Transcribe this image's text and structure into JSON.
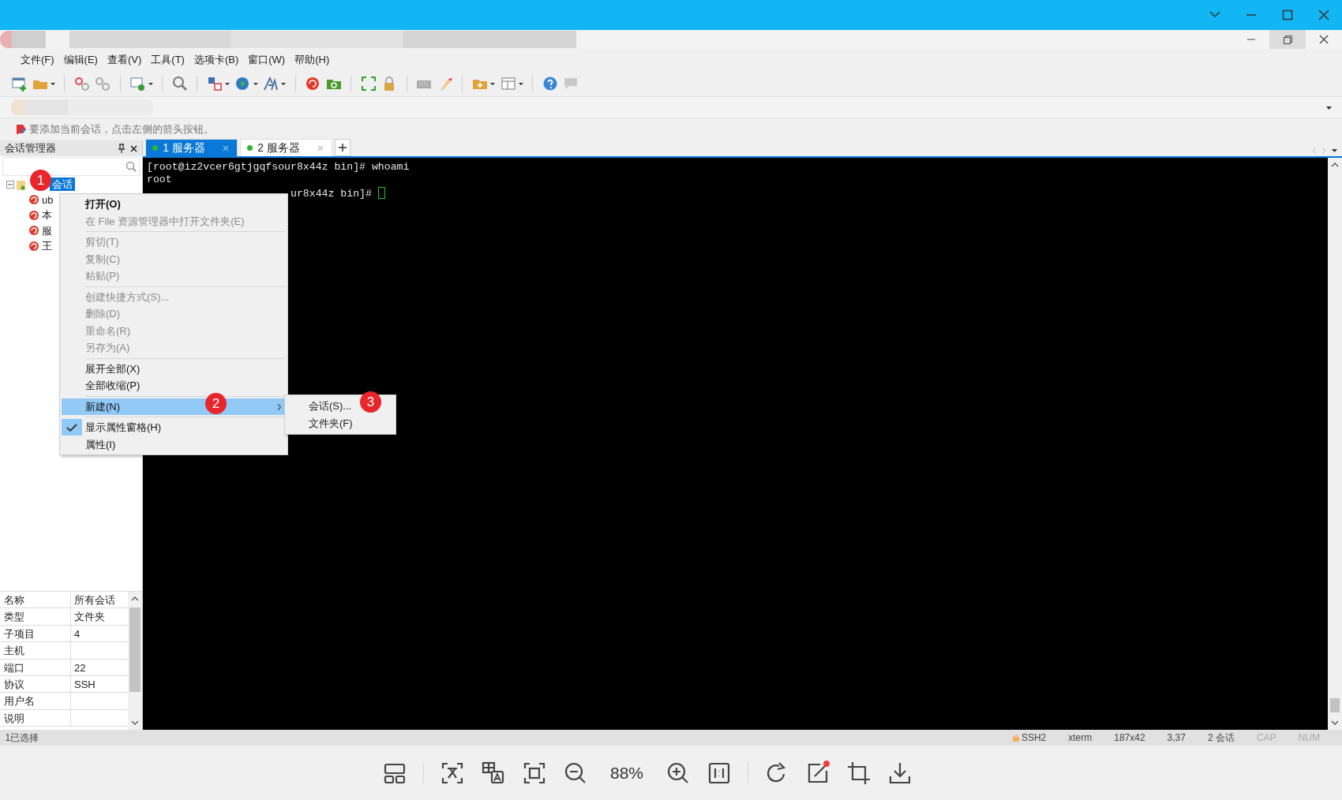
{
  "menu_bar": [
    "文件(F)",
    "编辑(E)",
    "查看(V)",
    "工具(T)",
    "选项卡(B)",
    "窗口(W)",
    "帮助(H)"
  ],
  "hint": "要添加当前会话，点击左侧的箭头按钮。",
  "session_manager": {
    "title": "会话管理器",
    "tree": [
      {
        "label": "会话",
        "selected": true,
        "expanded": true,
        "children": [
          {
            "label": "ub",
            "selected": false
          },
          {
            "label": "本",
            "selected": false
          },
          {
            "label": "服",
            "selected": false
          },
          {
            "label": "王",
            "selected": false
          }
        ]
      }
    ]
  },
  "properties": [
    {
      "name": "名称",
      "value": "所有会话"
    },
    {
      "name": "类型",
      "value": "文件夹"
    },
    {
      "name": "子项目",
      "value": "4"
    },
    {
      "name": "主机"
    },
    {
      "name": "端口",
      "value": "22"
    },
    {
      "name": "协议",
      "value": "SSH"
    },
    {
      "name": "用户名"
    },
    {
      "name": "说明"
    }
  ],
  "tabs": [
    {
      "label": "1 服务器",
      "selected": true
    },
    {
      "label": "2 服务器",
      "selected": false
    }
  ],
  "terminal": {
    "lines": [
      {
        "kind": "full",
        "text": "[root@iz2vcer6gtjgqfsour8x44z bin]# whoami",
        "cursor": false
      },
      {
        "kind": "full",
        "text": "root",
        "cursor": false
      },
      {
        "kind": "tail",
        "text": "ur8x44z bin]#",
        "cursor": true
      }
    ]
  },
  "context_menu": {
    "items": [
      {
        "kind": "item",
        "label": "打开(O)",
        "default": true,
        "disabled": false,
        "selected": false,
        "checked": false,
        "submenu": false
      },
      {
        "kind": "item",
        "label": "在 File 资源管理器中打开文件夹(E)",
        "default": false,
        "disabled": true,
        "selected": false,
        "checked": false,
        "submenu": false
      },
      {
        "kind": "separator"
      },
      {
        "kind": "item",
        "label": "剪切(T)",
        "default": false,
        "disabled": true,
        "selected": false,
        "checked": false,
        "submenu": false
      },
      {
        "kind": "item",
        "label": "复制(C)",
        "default": false,
        "disabled": true,
        "selected": false,
        "checked": false,
        "submenu": false
      },
      {
        "kind": "item",
        "label": "粘贴(P)",
        "default": false,
        "disabled": true,
        "selected": false,
        "checked": false,
        "submenu": false
      },
      {
        "kind": "separator"
      },
      {
        "kind": "item",
        "label": "创建快捷方式(S)...",
        "default": false,
        "disabled": true,
        "selected": false,
        "checked": false,
        "submenu": false
      },
      {
        "kind": "item",
        "label": "删除(D)",
        "default": false,
        "disabled": true,
        "selected": false,
        "checked": false,
        "submenu": false
      },
      {
        "kind": "item",
        "label": "重命名(R)",
        "default": false,
        "disabled": true,
        "selected": false,
        "checked": false,
        "submenu": false
      },
      {
        "kind": "item",
        "label": "另存为(A)",
        "default": false,
        "disabled": true,
        "selected": false,
        "checked": false,
        "submenu": false
      },
      {
        "kind": "separator"
      },
      {
        "kind": "item",
        "label": "展开全部(X)",
        "default": false,
        "disabled": false,
        "selected": false,
        "checked": false,
        "submenu": false
      },
      {
        "kind": "item",
        "label": "全部收缩(P)",
        "default": false,
        "disabled": false,
        "selected": false,
        "checked": false,
        "submenu": false
      },
      {
        "kind": "separator"
      },
      {
        "kind": "item",
        "label": "新建(N)",
        "default": false,
        "disabled": false,
        "selected": true,
        "checked": false,
        "submenu": true
      },
      {
        "kind": "separator"
      },
      {
        "kind": "item",
        "label": "显示属性窗格(H)",
        "default": false,
        "disabled": false,
        "selected": false,
        "checked": true,
        "submenu": false
      },
      {
        "kind": "item",
        "label": "属性(I)",
        "default": false,
        "disabled": false,
        "selected": false,
        "checked": false,
        "submenu": false
      }
    ]
  },
  "submenu": {
    "items": [
      {
        "label": "会话(S)...",
        "selected": false
      },
      {
        "label": "文件夹(F)",
        "selected": false
      }
    ]
  },
  "callouts": [
    "1",
    "2",
    "3"
  ],
  "status_bar": {
    "selection": "1已选择",
    "items": [
      {
        "text": "SSH2",
        "disabled": false
      },
      {
        "text": "xterm",
        "disabled": false
      },
      {
        "text": "187x42",
        "disabled": false
      },
      {
        "text": "3,37",
        "disabled": false
      },
      {
        "text": "2 会话",
        "disabled": false
      },
      {
        "text": "CAP",
        "disabled": true
      },
      {
        "text": "NUM",
        "disabled": true
      }
    ]
  },
  "viewer_toolbar": {
    "zoom": "88%"
  }
}
